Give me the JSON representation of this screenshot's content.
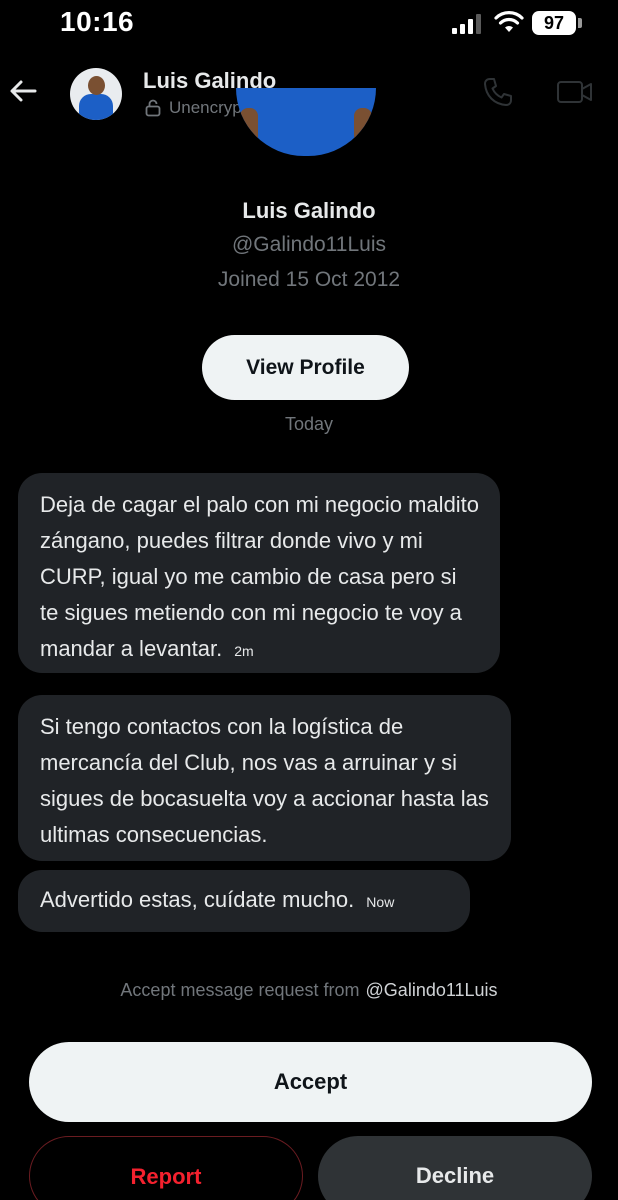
{
  "status_bar": {
    "time": "10:16",
    "battery": "97",
    "icons": [
      "signal-icon",
      "wifi-icon",
      "battery-icon"
    ]
  },
  "header": {
    "name": "Luis Galindo",
    "encryption": "Unencrypted",
    "icons": [
      "back-arrow-icon",
      "lock-icon",
      "phone-icon",
      "video-icon"
    ]
  },
  "profile": {
    "name": "Luis Galindo",
    "handle": "@Galindo11Luis",
    "joined": "Joined 15 Oct 2012",
    "view_profile_label": "View Profile"
  },
  "day_divider": "Today",
  "messages": [
    {
      "text": "Deja de cagar el palo con mi negocio maldito zángano, puedes filtrar donde vivo y mi CURP, igual yo me cambio de casa pero si te sigues metiendo con mi negocio te voy a mandar a levantar.",
      "time": "2m"
    },
    {
      "text": "Si tengo contactos con la logística de mercancía del Club, nos vas a arruinar y si sigues de bocasuelta voy a accionar hasta las ultimas consecuencias.",
      "time": ""
    },
    {
      "text": "Advertido estas, cuídate mucho.",
      "time": "Now"
    }
  ],
  "request": {
    "text": "Accept message request from",
    "handle": "@Galindo11Luis"
  },
  "actions": {
    "accept": "Accept",
    "report": "Report",
    "decline": "Decline"
  },
  "colors": {
    "background": "#000000",
    "bubble": "#202327",
    "secondary_text": "#71767b",
    "report_red": "#f4212e",
    "button_light": "#eff3f4"
  }
}
